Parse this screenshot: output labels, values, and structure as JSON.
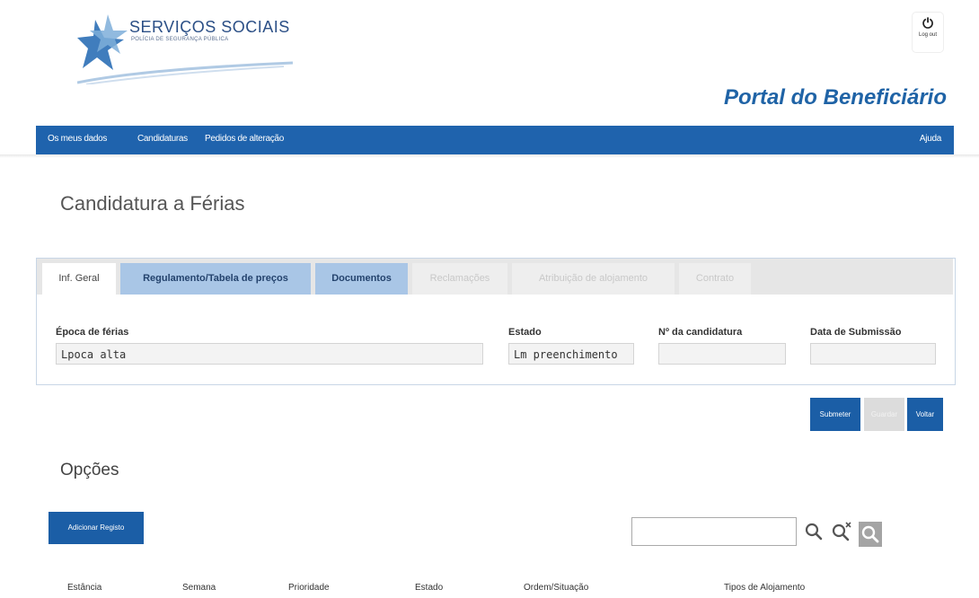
{
  "header": {
    "logo_title": "SERVIÇOS SOCIAIS",
    "logo_subtitle": "POLÍCIA DE SEGURANÇA PÚBLICA",
    "logout_label": "Log out",
    "portal_title": "Portal do Beneficiário"
  },
  "nav": {
    "items": [
      "Os meus dados",
      "Candidaturas",
      "Pedidos de alteração"
    ],
    "help": "Ajuda"
  },
  "page_title": "Candidatura a Férias",
  "tabs": [
    {
      "label": "Inf. Geral",
      "state": "active"
    },
    {
      "label": "Regulamento/Tabela de preços",
      "state": "enabled"
    },
    {
      "label": "Documentos",
      "state": "enabled"
    },
    {
      "label": "Reclamações",
      "state": "disabled"
    },
    {
      "label": "Atribuição de alojamento",
      "state": "disabled"
    },
    {
      "label": "Contrato",
      "state": "disabled"
    }
  ],
  "form": {
    "epoca_label": "Época de férias",
    "epoca_value": "Lpoca alta",
    "estado_label": "Estado",
    "estado_value": "Lm preenchimento",
    "num_label": "Nº da candidatura",
    "num_value": "",
    "data_label": "Data de Submissão",
    "data_value": ""
  },
  "actions": {
    "submeter": "Submeter",
    "guardar": "Guardar",
    "voltar": "Voltar"
  },
  "opcoes": {
    "title": "Opções",
    "add_button": "Adicionar Registo",
    "search_value": ""
  },
  "table": {
    "columns": [
      "Estância",
      "Semana",
      "Prioridade",
      "Estado",
      "Ordem/Situação",
      "Tipos de Alojamento"
    ]
  },
  "colors": {
    "brand_blue": "#1f63ad",
    "tab_blue": "#a9c6e6",
    "title_blue": "#1f63a6"
  }
}
